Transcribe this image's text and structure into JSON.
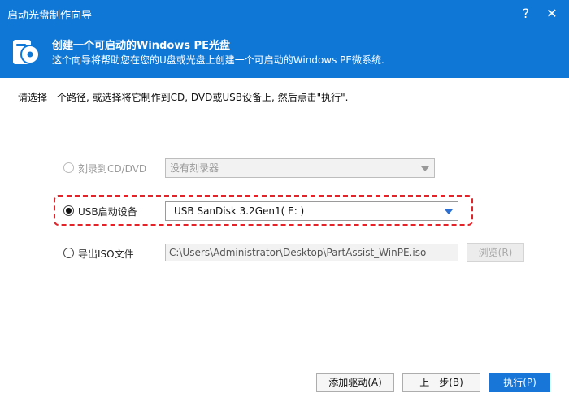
{
  "window": {
    "title": "启动光盘制作向导",
    "help_label": "?",
    "close_label": "✕"
  },
  "header": {
    "title": "创建一个可启动的Windows PE光盘",
    "subtitle": "这个向导将帮助您在您的U盘或光盘上创建一个可启动的Windows PE微系统."
  },
  "instruction": "请选择一个路径, 或选择将它制作到CD, DVD或USB设备上, 然后点击\"执行\".",
  "options": {
    "cd_dvd": {
      "label": "刻录到CD/DVD",
      "select_value": "没有刻录器",
      "enabled": false,
      "checked": false
    },
    "usb": {
      "label": "USB启动设备",
      "select_value": "USB SanDisk 3.2Gen1( E: )",
      "enabled": true,
      "checked": true
    },
    "iso": {
      "label": "导出ISO文件",
      "path_value": "C:\\Users\\Administrator\\Desktop\\PartAssist_WinPE.iso",
      "browse_label": "浏览(R)",
      "enabled": true,
      "checked": false
    }
  },
  "footer": {
    "add_driver_label": "添加驱动(A)",
    "back_label": "上一步(B)",
    "execute_label": "执行(P)"
  },
  "colors": {
    "accent": "#0f78d6",
    "highlight": "#e0242a",
    "primary_button": "#1876d9"
  }
}
